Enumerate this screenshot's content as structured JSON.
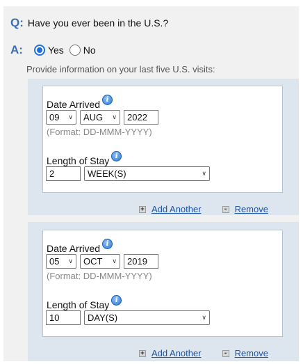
{
  "question": {
    "q_letter": "Q:",
    "text": "Have you ever been in the U.S.?"
  },
  "answer": {
    "a_letter": "A:",
    "options": [
      {
        "label": "Yes",
        "selected": true
      },
      {
        "label": "No",
        "selected": false
      }
    ]
  },
  "instruction": "Provide information on your last five U.S. visits:",
  "visits": [
    {
      "date_label": "Date Arrived",
      "day": "09",
      "month": "AUG",
      "year": "2022",
      "format_hint": "(Format: DD-MMM-YYYY)",
      "stay_label": "Length of Stay",
      "stay_value": "2",
      "stay_unit": "WEEK(S)",
      "add_label": "Add Another",
      "remove_label": "Remove"
    },
    {
      "date_label": "Date Arrived",
      "day": "05",
      "month": "OCT",
      "year": "2019",
      "format_hint": "(Format: DD-MMM-YYYY)",
      "stay_label": "Length of Stay",
      "stay_value": "10",
      "stay_unit": "DAY(S)",
      "add_label": "Add Another",
      "remove_label": "Remove"
    }
  ],
  "icons": {
    "info": "info-icon",
    "add": "plus-icon",
    "remove": "minus-icon",
    "dropdown": "chevron-down-icon"
  },
  "colors": {
    "accent": "#3a6fb4",
    "link": "#1d55a3",
    "panel": "#dde6ef",
    "radio_selected": "#1e6fdb"
  }
}
